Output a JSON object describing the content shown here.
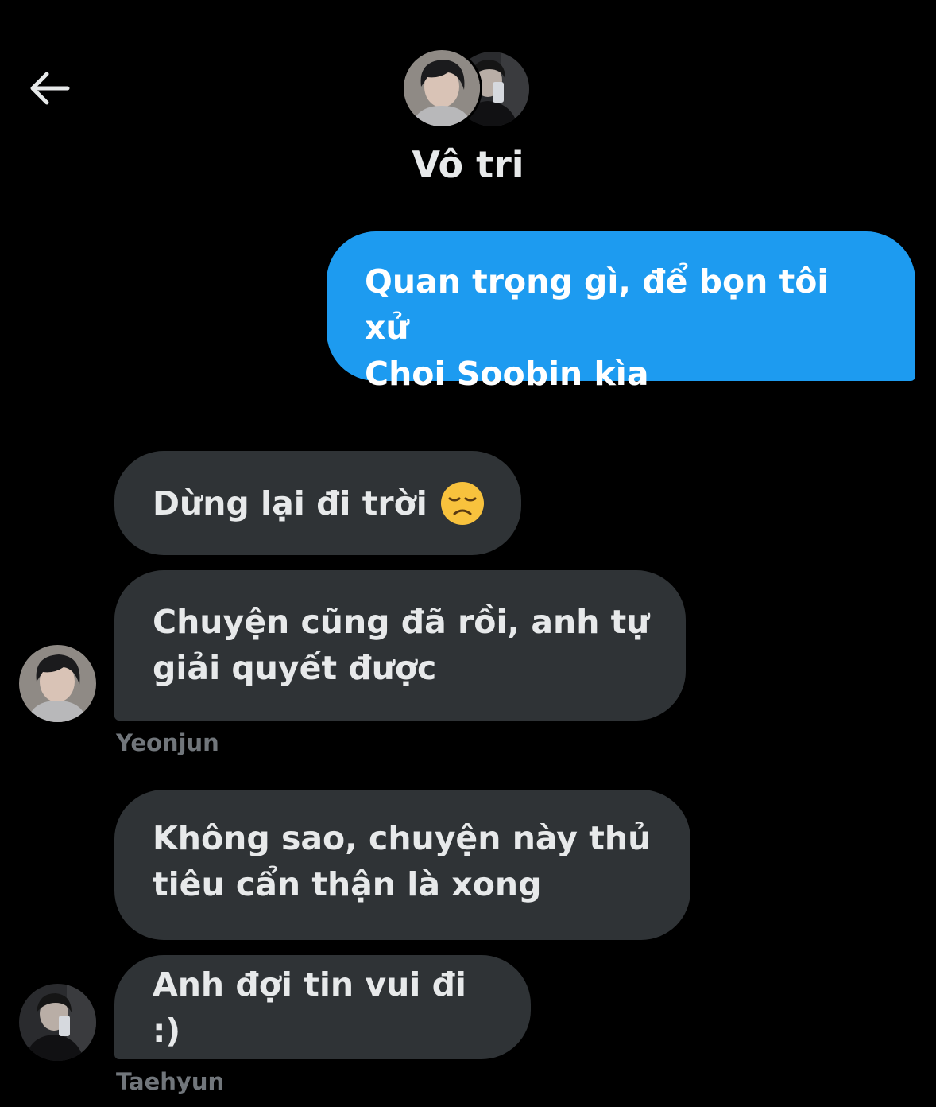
{
  "header": {
    "back_icon": "arrow-left-icon",
    "title": "Vô tri",
    "avatars": [
      "avatar-yeonjun",
      "avatar-taehyun"
    ]
  },
  "messages": [
    {
      "direction": "sent",
      "text": "Quan trọng gì, để bọn tôi xử Choi Soobin kìa",
      "lines": [
        "Quan trọng gì, để bọn tôi xử",
        "Choi Soobin kìa"
      ]
    },
    {
      "direction": "received",
      "text": "Dừng lại đi trời",
      "emoji": "disappointed-face-emoji"
    },
    {
      "direction": "received",
      "text": "Chuyện cũng đã rồi, anh tự giải quyết được",
      "lines": [
        "Chuyện cũng đã rồi, anh tự",
        "giải quyết được"
      ],
      "sender": "Yeonjun"
    },
    {
      "direction": "received",
      "text": "Không sao, chuyện này thủ tiêu cẩn thận là xong",
      "lines": [
        "Không sao, chuyện này thủ",
        "tiêu cẩn thận là xong"
      ]
    },
    {
      "direction": "received",
      "text": "Anh đợi tin vui đi :)",
      "sender": "Taehyun"
    }
  ],
  "colors": {
    "background": "#000000",
    "sent_bubble": "#1d9bf0",
    "received_bubble": "#2f3336",
    "text_primary": "#e7e9ea",
    "text_secondary": "#71767b"
  }
}
